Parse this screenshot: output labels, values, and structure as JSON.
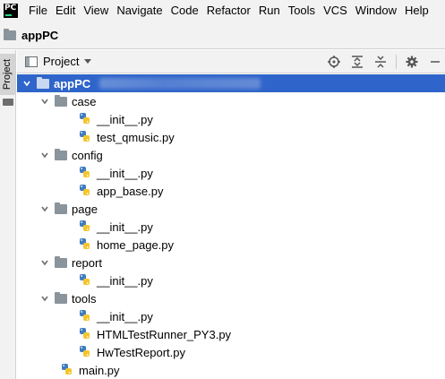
{
  "menu": {
    "logo_text": "PC",
    "items": [
      "File",
      "Edit",
      "View",
      "Navigate",
      "Code",
      "Refactor",
      "Run",
      "Tools",
      "VCS",
      "Window",
      "Help"
    ]
  },
  "nav": {
    "project_name": "appPC"
  },
  "tool_strip": {
    "tab_label": "Project"
  },
  "tool_window": {
    "view_label": "Project"
  },
  "tree": {
    "root": {
      "label": "appPC"
    },
    "nodes": [
      {
        "label": "case",
        "kind": "folder",
        "depth": 1
      },
      {
        "label": "__init__.py",
        "kind": "file",
        "depth": 2
      },
      {
        "label": "test_qmusic.py",
        "kind": "file",
        "depth": 2
      },
      {
        "label": "config",
        "kind": "folder",
        "depth": 1
      },
      {
        "label": "__init__.py",
        "kind": "file",
        "depth": 2
      },
      {
        "label": "app_base.py",
        "kind": "file",
        "depth": 2
      },
      {
        "label": "page",
        "kind": "folder",
        "depth": 1
      },
      {
        "label": "__init__.py",
        "kind": "file",
        "depth": 2
      },
      {
        "label": "home_page.py",
        "kind": "file",
        "depth": 2
      },
      {
        "label": "report",
        "kind": "folder",
        "depth": 1
      },
      {
        "label": "__init__.py",
        "kind": "file",
        "depth": 2
      },
      {
        "label": "tools",
        "kind": "folder",
        "depth": 1
      },
      {
        "label": "__init__.py",
        "kind": "file",
        "depth": 2
      },
      {
        "label": "HTMLTestRunner_PY3.py",
        "kind": "file",
        "depth": 2
      },
      {
        "label": "HwTestReport.py",
        "kind": "file",
        "depth": 2
      },
      {
        "label": "main.py",
        "kind": "file",
        "depth": 1
      }
    ]
  },
  "colors": {
    "selection": "#2f65ca",
    "python_blue": "#3f7cc0",
    "python_yellow": "#f4c52c"
  }
}
